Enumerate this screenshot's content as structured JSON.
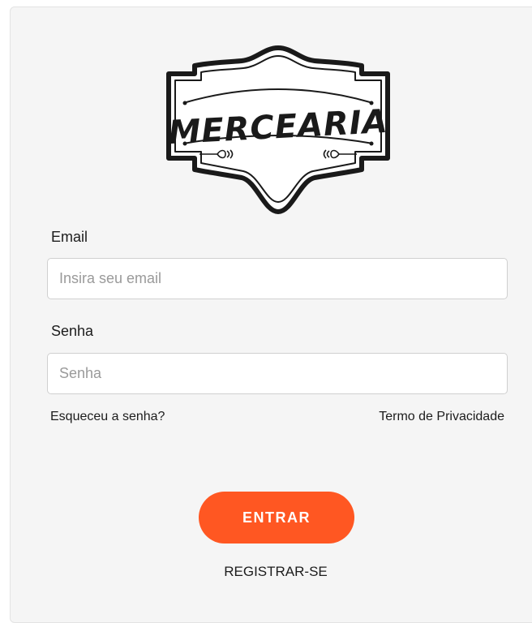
{
  "brand": {
    "logo_text": "MERCEARIA"
  },
  "form": {
    "email_label": "Email",
    "email_placeholder": "Insira seu email",
    "email_value": "",
    "password_label": "Senha",
    "password_placeholder": "Senha",
    "password_value": ""
  },
  "links": {
    "forgot_password": "Esqueceu a senha?",
    "privacy": "Termo de Privacidade"
  },
  "actions": {
    "submit_label": "ENTRAR",
    "register_label": "REGISTRAR-SE"
  },
  "colors": {
    "accent": "#ff5722",
    "card_background": "#f5f5f5",
    "logo_ink": "#1a1a1a"
  }
}
